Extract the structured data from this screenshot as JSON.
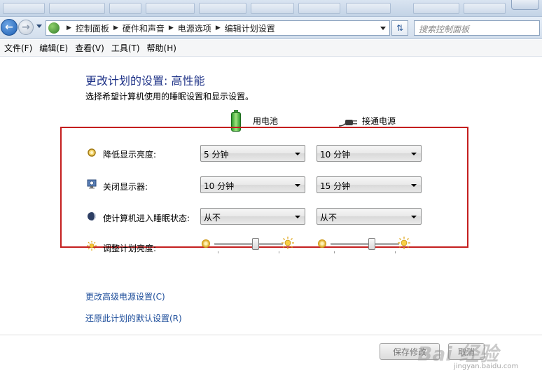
{
  "address": {
    "crumbs": [
      "控制面板",
      "硬件和声音",
      "电源选项",
      "编辑计划设置"
    ],
    "search_placeholder": "搜索控制面板"
  },
  "menu": [
    "文件(F)",
    "编辑(E)",
    "查看(V)",
    "工具(T)",
    "帮助(H)"
  ],
  "page": {
    "title": "更改计划的设置: 高性能",
    "subtitle": "选择希望计算机使用的睡眠设置和显示设置。"
  },
  "columns": {
    "battery": "用电池",
    "plugged": "接通电源"
  },
  "settings": [
    {
      "label": "降低显示亮度:",
      "icon": "dim-display-icon",
      "battery": "5 分钟",
      "plugged": "10 分钟"
    },
    {
      "label": "关闭显示器:",
      "icon": "monitor-off-icon",
      "battery": "10 分钟",
      "plugged": "15 分钟"
    },
    {
      "label": "使计算机进入睡眠状态:",
      "icon": "sleep-icon",
      "battery": "从不",
      "plugged": "从不"
    }
  ],
  "brightness": {
    "label": "调整计划亮度:",
    "battery_level": 0.6,
    "plugged_level": 0.6
  },
  "links": {
    "advanced": "更改高级电源设置(C)",
    "restore": "还原此计划的默认设置(R)"
  },
  "buttons": {
    "save": "保存修改",
    "cancel": "取消"
  },
  "watermark": {
    "logo": "Bai 经验",
    "url": "jingyan.baidu.com"
  },
  "colors": {
    "title": "#1e3287",
    "link": "#1e4e9b",
    "highlight_box": "#c41e1e"
  }
}
